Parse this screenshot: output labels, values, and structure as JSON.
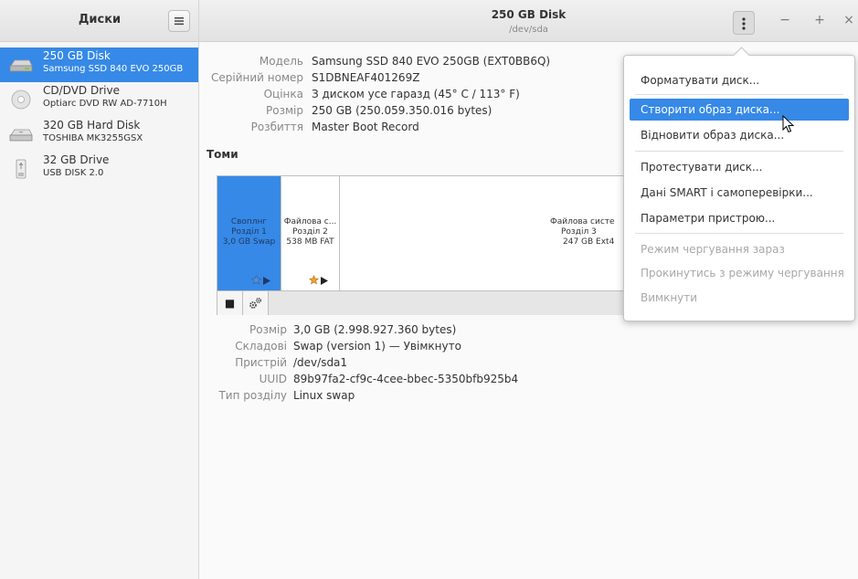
{
  "sidebar": {
    "title": "Диски",
    "drives": [
      {
        "name": "250 GB Disk",
        "sub": "Samsung SSD 840 EVO 250GB",
        "icon": "ssd-icon",
        "selected": true
      },
      {
        "name": "CD/DVD Drive",
        "sub": "Optiarc DVD RW AD-7710H",
        "icon": "optical-drive-icon",
        "selected": false
      },
      {
        "name": "320 GB Hard Disk",
        "sub": "TOSHIBA MK3255GSX",
        "icon": "hard-disk-icon",
        "selected": false
      },
      {
        "name": "32 GB Drive",
        "sub": "USB DISK 2.0",
        "icon": "usb-drive-icon",
        "selected": false
      }
    ]
  },
  "header": {
    "title": "250 GB Disk",
    "subtitle": "/dev/sda",
    "minimize": "−",
    "maximize": "+",
    "close": "×"
  },
  "disk_info": [
    {
      "key": "Модель",
      "value": "Samsung SSD 840 EVO 250GB (EXT0BB6Q)"
    },
    {
      "key": "Серійний номер",
      "value": "S1DBNEAF401269Z"
    },
    {
      "key": "Оцінка",
      "value": "З диском усе гаразд (45° C / 113° F)"
    },
    {
      "key": "Розмір",
      "value": "250 GB (250.059.350.016 bytes)"
    },
    {
      "key": "Розбиття",
      "value": "Master Boot Record"
    }
  ],
  "volumes": {
    "title": "Томи",
    "segments": [
      {
        "l1": "Своплнг",
        "l2": "Розділ 1",
        "l3": "3,0 GB Swap",
        "selected": true
      },
      {
        "l1": "Файлова с...",
        "l2": "Розділ 2",
        "l3": "538 MB FAT",
        "selected": false
      },
      {
        "l1": "Файлова систе",
        "l2": "Розділ 3",
        "l3": "247 GB Ext4",
        "selected": false
      }
    ],
    "stop_label": "■",
    "settings_label": "⚙"
  },
  "partition_info": [
    {
      "key": "Розмір",
      "value": "3,0 GB (2.998.927.360 bytes)"
    },
    {
      "key": "Складові",
      "value": "Swap (version 1) — Увімкнуто"
    },
    {
      "key": "Пристрій",
      "value": "/dev/sda1"
    },
    {
      "key": "UUID",
      "value": "89b97fa2-cf9c-4cee-bbec-5350bfb925b4"
    },
    {
      "key": "Тип розділу",
      "value": "Linux swap"
    }
  ],
  "menu": {
    "items": [
      {
        "label": "Форматувати диск...",
        "state": "normal"
      },
      {
        "label": "Створити образ диска...",
        "state": "highlighted"
      },
      {
        "label": "Відновити образ диска...",
        "state": "normal"
      },
      {
        "label": "Протестувати диск...",
        "state": "normal"
      },
      {
        "label": "Дані SMART і самоперевірки...",
        "state": "normal"
      },
      {
        "label": "Параметри пристрою...",
        "state": "normal"
      },
      {
        "label": "Режим чергування зараз",
        "state": "disabled"
      },
      {
        "label": "Прокинутись з режиму чергування",
        "state": "disabled"
      },
      {
        "label": "Вимкнути",
        "state": "disabled"
      }
    ]
  },
  "colors": {
    "accent": "#3689e6",
    "star": "#f0a030"
  }
}
